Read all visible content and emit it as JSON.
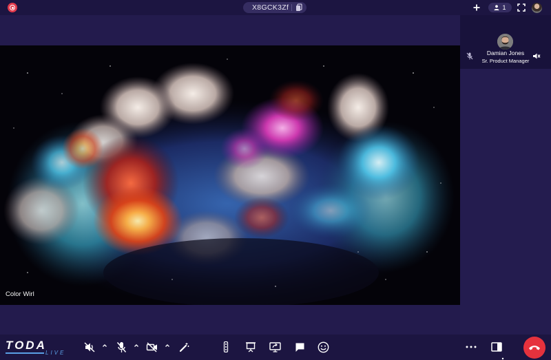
{
  "header": {
    "room_code": "X8GCK3Zf",
    "participant_count": "1"
  },
  "stage": {
    "caption": "Color Wirl"
  },
  "participant": {
    "name": "Damian Jones",
    "title": "Sr. Product Manager"
  },
  "branding": {
    "logo_text": "TODA",
    "logo_sub": "LIVE"
  },
  "colors": {
    "background": "#231b4d",
    "bars": "#1c1541",
    "record": "#e23b4d",
    "hangup": "#e6323d",
    "logo_accent": "#5aa0e6"
  },
  "icons": {
    "top": [
      "record-icon",
      "copy-icon",
      "plus-icon",
      "person-icon",
      "fullscreen-icon",
      "avatar"
    ],
    "bottom": [
      "speaker-muted-icon",
      "mic-muted-icon",
      "camera-off-icon",
      "magic-wand-icon",
      "vertical-dots-icon",
      "presentation-icon",
      "screen-share-icon",
      "chat-icon",
      "emoji-icon",
      "more-icon",
      "side-panel-icon",
      "hangup-icon"
    ]
  }
}
